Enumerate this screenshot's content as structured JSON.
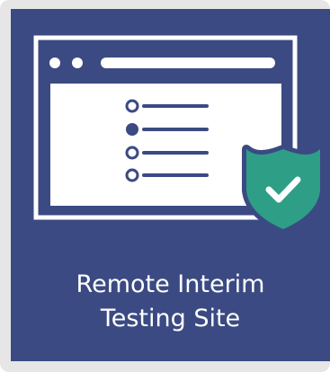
{
  "tile": {
    "title_line1": "Remote Interim",
    "title_line2": "Testing Site",
    "background_color": "#3b4a82",
    "frame_color": "#e6e6e6",
    "icon_stroke_color": "#ffffff",
    "shield_color": "#2e9e86",
    "icons": [
      "browser-window-icon",
      "radio-list-icon",
      "shield-check-icon"
    ]
  }
}
